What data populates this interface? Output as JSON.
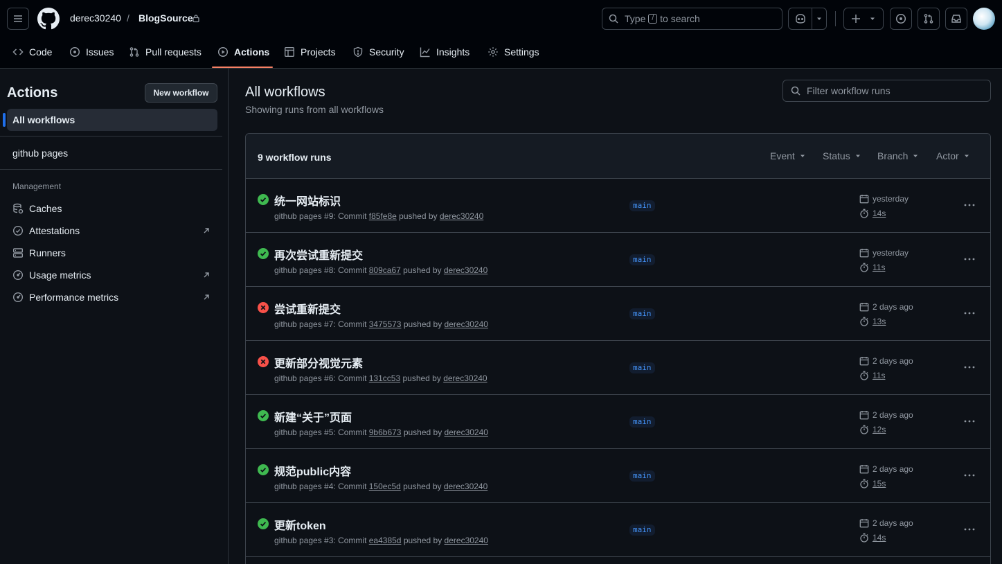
{
  "header": {
    "owner": "derec30240",
    "separator": "/",
    "repo": "BlogSource",
    "search_prefix": "Type",
    "search_key": "/",
    "search_suffix": "to search"
  },
  "tabs": [
    {
      "label": "Code"
    },
    {
      "label": "Issues"
    },
    {
      "label": "Pull requests"
    },
    {
      "label": "Actions"
    },
    {
      "label": "Projects"
    },
    {
      "label": "Security"
    },
    {
      "label": "Insights"
    },
    {
      "label": "Settings"
    }
  ],
  "sidebar": {
    "title": "Actions",
    "new_workflow": "New workflow",
    "all_workflows": "All workflows",
    "workflow": "github pages",
    "management_heading": "Management",
    "management": [
      {
        "label": "Caches",
        "icon": "cache-icon"
      },
      {
        "label": "Attestations",
        "icon": "verified-icon"
      },
      {
        "label": "Runners",
        "icon": "server-icon"
      },
      {
        "label": "Usage metrics",
        "icon": "meter-icon"
      },
      {
        "label": "Performance metrics",
        "icon": "meter-icon"
      }
    ]
  },
  "main": {
    "title": "All workflows",
    "subtitle": "Showing runs from all workflows",
    "filter_placeholder": "Filter workflow runs",
    "runs_count": "9 workflow runs",
    "filters": [
      "Event",
      "Status",
      "Branch",
      "Actor"
    ],
    "runs": [
      {
        "title": "统一网站标识",
        "status": "success",
        "prefix": "github pages #9: Commit",
        "commit": "f85fe8e",
        "pushed": "pushed by",
        "user": "derec30240",
        "branch": "main",
        "when": "yesterday",
        "duration": "14s"
      },
      {
        "title": "再次尝试重新提交",
        "status": "success",
        "prefix": "github pages #8: Commit",
        "commit": "809ca67",
        "pushed": "pushed by",
        "user": "derec30240",
        "branch": "main",
        "when": "yesterday",
        "duration": "11s"
      },
      {
        "title": "尝试重新提交",
        "status": "failure",
        "prefix": "github pages #7: Commit",
        "commit": "3475573",
        "pushed": "pushed by",
        "user": "derec30240",
        "branch": "main",
        "when": "2 days ago",
        "duration": "13s"
      },
      {
        "title": "更新部分视觉元素",
        "status": "failure",
        "prefix": "github pages #6: Commit",
        "commit": "131cc53",
        "pushed": "pushed by",
        "user": "derec30240",
        "branch": "main",
        "when": "2 days ago",
        "duration": "11s"
      },
      {
        "title": "新建“关于”页面",
        "status": "success",
        "prefix": "github pages #5: Commit",
        "commit": "9b6b673",
        "pushed": "pushed by",
        "user": "derec30240",
        "branch": "main",
        "when": "2 days ago",
        "duration": "12s"
      },
      {
        "title": "规范public内容",
        "status": "success",
        "prefix": "github pages #4: Commit",
        "commit": "150ec5d",
        "pushed": "pushed by",
        "user": "derec30240",
        "branch": "main",
        "when": "2 days ago",
        "duration": "15s"
      },
      {
        "title": "更新token",
        "status": "success",
        "prefix": "github pages #3: Commit",
        "commit": "ea4385d",
        "pushed": "pushed by",
        "user": "derec30240",
        "branch": "main",
        "when": "2 days ago",
        "duration": "14s"
      }
    ]
  },
  "colors": {
    "success": "#3fb950",
    "failure": "#f85149",
    "accent": "#f78166",
    "link": "#4493f8"
  }
}
